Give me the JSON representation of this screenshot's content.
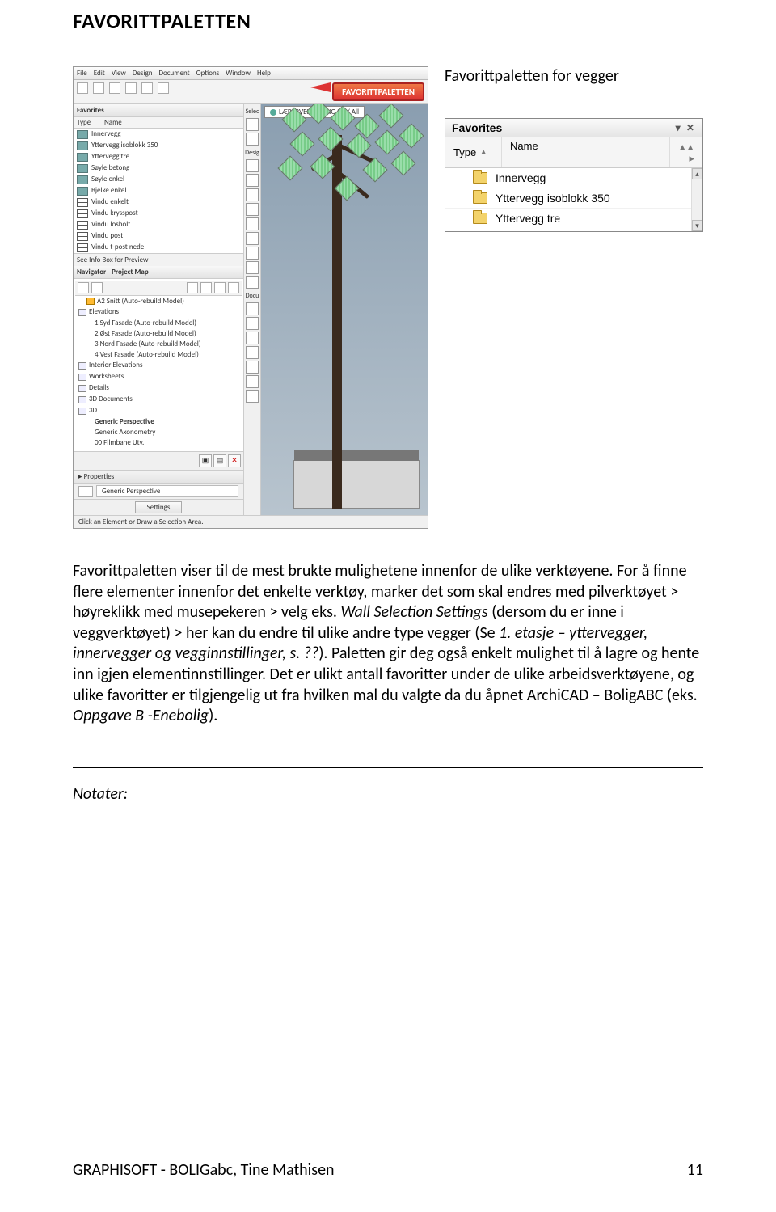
{
  "title": "FAVORITTPALETTEN",
  "caption_right": "Favorittpaletten for vegger",
  "menubar": [
    "File",
    "Edit",
    "View",
    "Design",
    "Document",
    "Options",
    "Window",
    "Help"
  ],
  "callout_label": "FAVORITTPALETTEN",
  "favorites_mini": {
    "header": "Favorites",
    "col_type": "Type",
    "col_name": "Name",
    "items": [
      "Innervegg",
      "Yttervegg isoblokk 350",
      "Yttervegg tre",
      "Søyle betong",
      "Søyle enkel",
      "Bjelke enkel",
      "Vindu enkelt",
      "Vindu krysspost",
      "Vindu losholt",
      "Vindu post",
      "Vindu t-post nede"
    ],
    "info": "See Info Box for Preview"
  },
  "navigator": {
    "header": "Navigator - Project Map",
    "groups": {
      "elevations": "Elevations",
      "sections_item": "A2 Snitt (Auto-rebuild Model)",
      "elev_items": [
        "1 Syd Fasade (Auto-rebuild Model)",
        "2 Øst Fasade (Auto-rebuild Model)",
        "3 Nord Fasade (Auto-rebuild Model)",
        "4 Vest Fasade (Auto-rebuild Model)"
      ],
      "interior": "Interior Elevations",
      "worksheets": "Worksheets",
      "details": "Details",
      "docs3d": "3D Documents",
      "d3": "3D",
      "d3_items": [
        "Generic Perspective",
        "Generic Axonometry",
        "00 Filmbane Utv."
      ]
    },
    "properties": "Properties",
    "current_view": "Generic Perspective",
    "settings_btn": "Settings"
  },
  "toolbox_labels": [
    "Selec",
    "Desig",
    "Docu"
  ],
  "viewport_tab": "LÆRERVEILEDNING 3D / All",
  "status_text": "Click an Element or Draw a Selection Area.",
  "fav_panel": {
    "title": "Favorites",
    "col_type": "Type",
    "col_name": "Name",
    "items": [
      "Innervegg",
      "Yttervegg isoblokk 350",
      "Yttervegg tre"
    ]
  },
  "body_paragraph_parts": {
    "p1a": "Favorittpaletten viser til de mest brukte mulighetene innenfor de ulike verktøyene. For å finne flere elementer innenfor det enkelte verktøy, marker det som skal endres med pilverktøyet > høyreklikk med musepekeren > velg eks. ",
    "p1i1": "Wall Selection Settings",
    "p1b": " (dersom du er inne i veggverktøyet) > her kan du endre til ulike andre type vegger (Se ",
    "p1i2": "1. etasje – yttervegger, innervegger og vegginnstillinger, s. ??",
    "p1c": "). Paletten gir deg også enkelt mulighet til å lagre og hente inn igjen elementinnstillinger. Det er ulikt antall favoritter under de ulike arbeidsverktøyene, og ulike favoritter er tilgjengelig ut fra hvilken mal du valgte da du åpnet ArchiCAD – BoligABC (eks. ",
    "p1i3": "Oppgave B  -Enebolig",
    "p1d": ")."
  },
  "notes_label": "Notater:",
  "footer_left": "GRAPHISOFT - BOLIGabc, Tine Mathisen",
  "footer_right": "11"
}
